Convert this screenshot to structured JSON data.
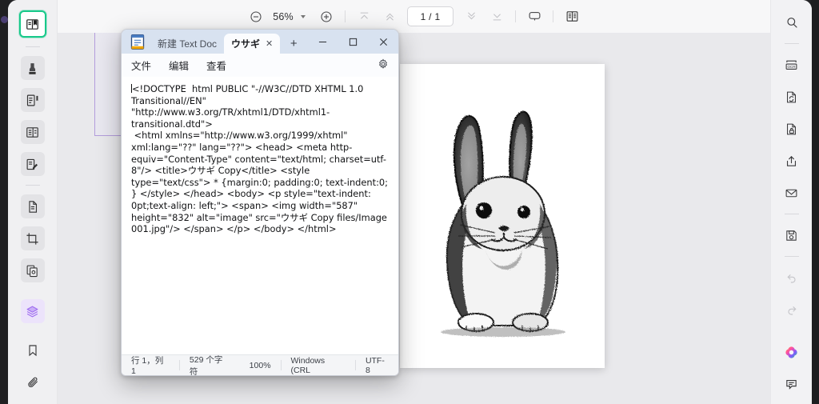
{
  "app": {
    "name": "pdf-reader",
    "accent_green": "#18c98a",
    "accent_purple": "#a06ef0"
  },
  "toolbar": {
    "zoom_out_icon": "minus-circle-icon",
    "zoom_level": "56%",
    "zoom_dropdown_icon": "chevron-down-icon",
    "zoom_in_icon": "plus-circle-icon",
    "first_page_icon": "first-page-icon",
    "prev_page_icon": "prev-page-icon",
    "page_indicator": "1 / 1",
    "next_page_icon": "next-page-icon",
    "last_page_icon": "last-page-icon",
    "presentation_icon": "presentation-icon",
    "reading_mode_icon": "reading-mode-icon"
  },
  "left_rail": {
    "items": [
      {
        "name": "sidebar-item-read",
        "icon": "book-open-icon",
        "state": "active-green"
      },
      {
        "name": "sidebar-item-highlight",
        "icon": "highlighter-icon",
        "state": "boxed"
      },
      {
        "name": "sidebar-item-annotate",
        "icon": "note-edit-icon",
        "state": "boxed"
      },
      {
        "name": "sidebar-item-outline",
        "icon": "document-list-icon",
        "state": "boxed"
      },
      {
        "name": "sidebar-item-sign",
        "icon": "signature-icon",
        "state": "boxed"
      },
      {
        "name": "sidebar-item-pages",
        "icon": "copy-page-icon",
        "state": "boxed"
      },
      {
        "name": "sidebar-item-crop",
        "icon": "crop-icon",
        "state": "boxed"
      },
      {
        "name": "sidebar-item-compare",
        "icon": "stacked-pages-icon",
        "state": "boxed"
      },
      {
        "name": "sidebar-item-layers",
        "icon": "layers-icon",
        "state": "layers"
      },
      {
        "name": "sidebar-item-bookmark",
        "icon": "bookmark-icon",
        "state": "plain"
      },
      {
        "name": "sidebar-item-attachment",
        "icon": "paperclip-icon",
        "state": "plain"
      }
    ]
  },
  "right_rail": {
    "items": [
      {
        "name": "rightbar-search",
        "icon": "search-icon"
      },
      {
        "name": "rightbar-ocr",
        "icon": "ocr-icon"
      },
      {
        "name": "rightbar-convert",
        "icon": "file-convert-icon"
      },
      {
        "name": "rightbar-protect",
        "icon": "file-lock-icon"
      },
      {
        "name": "rightbar-share",
        "icon": "share-upload-icon"
      },
      {
        "name": "rightbar-mail",
        "icon": "envelope-icon"
      },
      {
        "name": "rightbar-save",
        "icon": "save-disk-icon"
      },
      {
        "name": "rightbar-undo",
        "icon": "undo-icon"
      },
      {
        "name": "rightbar-redo",
        "icon": "redo-icon"
      },
      {
        "name": "rightbar-ai",
        "icon": "ai-sparkle-icon"
      },
      {
        "name": "rightbar-comment",
        "icon": "comment-icon"
      }
    ]
  },
  "document": {
    "page_label": "1 / 1",
    "image_alt": "rabbit-pencil-drawing"
  },
  "notepad": {
    "app_icon": "notepad-icon",
    "tabs": [
      {
        "label": "新建 Text Doc",
        "active": false,
        "closable": false
      },
      {
        "label": "ウサギ",
        "active": true,
        "closable": true,
        "close_icon": "close-icon"
      }
    ],
    "new_tab_icon": "plus-icon",
    "window_buttons": {
      "minimize_icon": "minimize-icon",
      "maximize_icon": "maximize-icon",
      "close_icon": "close-icon"
    },
    "menu": [
      "文件",
      "编辑",
      "查看"
    ],
    "settings_icon": "gear-icon",
    "content": "<!DOCTYPE  html PUBLIC \"-//W3C//DTD XHTML 1.0 Transitional//EN\"\n\"http://www.w3.org/TR/xhtml1/DTD/xhtml1-transitional.dtd\">\n <html xmlns=\"http://www.w3.org/1999/xhtml\" xml:lang=\"??\" lang=\"??\"> <head> <meta http-equiv=\"Content-Type\" content=\"text/html; charset=utf-8\"/> <title>ウサギ Copy</title> <style type=\"text/css\"> * {margin:0; padding:0; text-indent:0; } </style> </head> <body> <p style=\"text-indent: 0pt;text-align: left;\"> <span> <img width=\"587\" height=\"832\" alt=\"image\" src=\"ウサギ Copy files/Image 001.jpg\"/> </span> </p> </body> </html>",
    "status": {
      "cursor": "行 1，列 1",
      "char_count": "529 个字符",
      "zoom": "100%",
      "line_ending": "Windows (CRL",
      "encoding": "UTF-8"
    }
  }
}
